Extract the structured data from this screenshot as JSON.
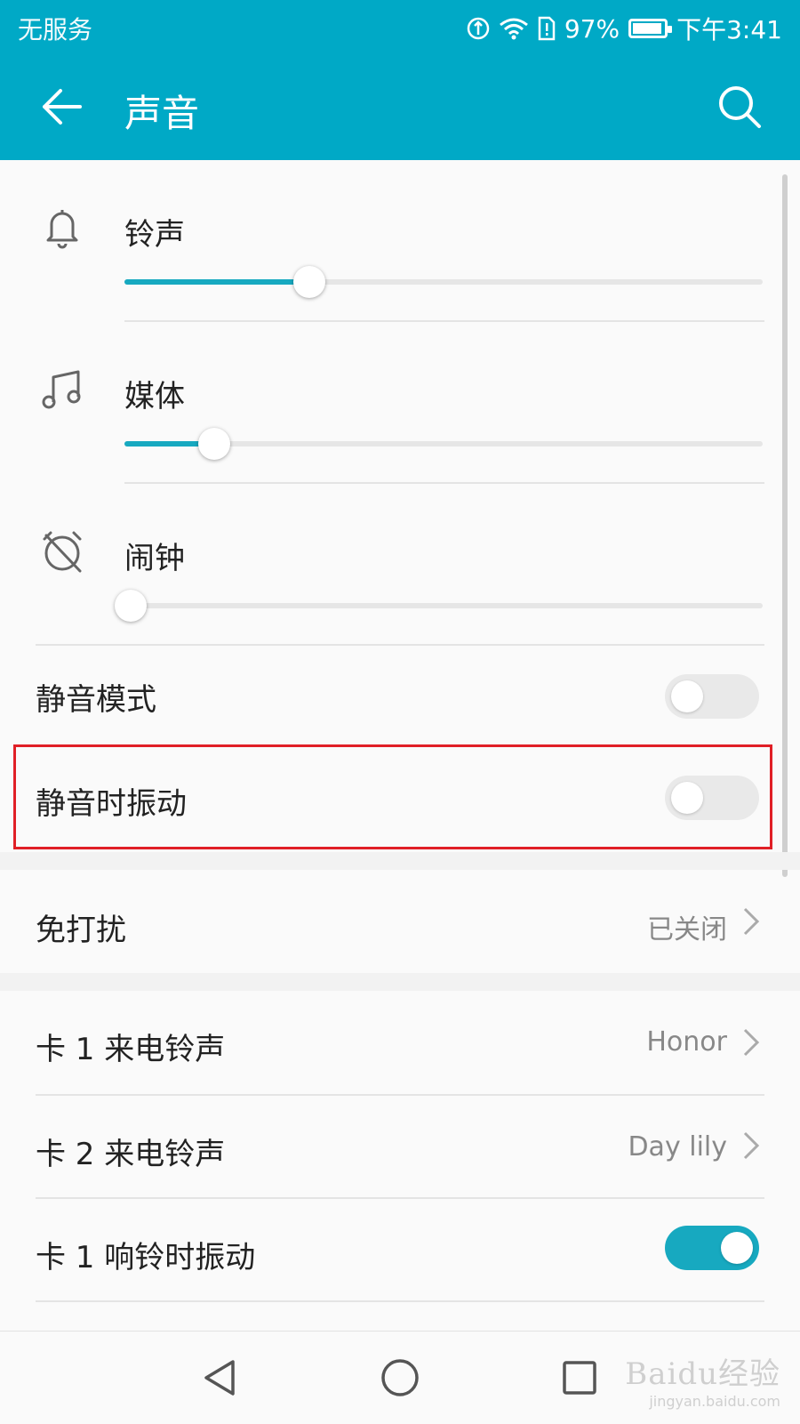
{
  "status_bar": {
    "carrier": "无服务",
    "battery_pct": "97%",
    "time": "下午3:41",
    "battery_level": 0.97,
    "icons": [
      "data-saver-icon",
      "wifi-icon",
      "sim-alert-icon",
      "battery-icon"
    ]
  },
  "app_bar": {
    "title": "声音",
    "back_icon": "back-arrow-icon",
    "search_icon": "search-icon"
  },
  "volumes": [
    {
      "label": "铃声",
      "icon": "bell-icon",
      "level": 0.29
    },
    {
      "label": "媒体",
      "icon": "music-note-icon",
      "level": 0.14
    },
    {
      "label": "闹钟",
      "icon": "alarm-off-icon",
      "level": 0.01
    }
  ],
  "toggles": [
    {
      "label": "静音模式",
      "on": false
    },
    {
      "label": "静音时振动",
      "on": false,
      "highlighted": true
    }
  ],
  "dnd": {
    "label": "免打扰",
    "value": "已关闭"
  },
  "ringtones": [
    {
      "label": "卡 1 来电铃声",
      "value": "Honor"
    },
    {
      "label": "卡 2 来电铃声",
      "value": "Day lily"
    }
  ],
  "vibrate_on_ring": {
    "label": "卡 1 响铃时振动",
    "on": true
  },
  "nav": {
    "back": "nav-back-icon",
    "home": "nav-home-icon",
    "recents": "nav-recents-icon"
  },
  "watermark": {
    "brand": "Baidu经验",
    "url": "jingyan.baidu.com"
  },
  "colors": {
    "accent": "#00a9c6",
    "slider": "#17a9c0",
    "highlight": "#e01f26"
  }
}
